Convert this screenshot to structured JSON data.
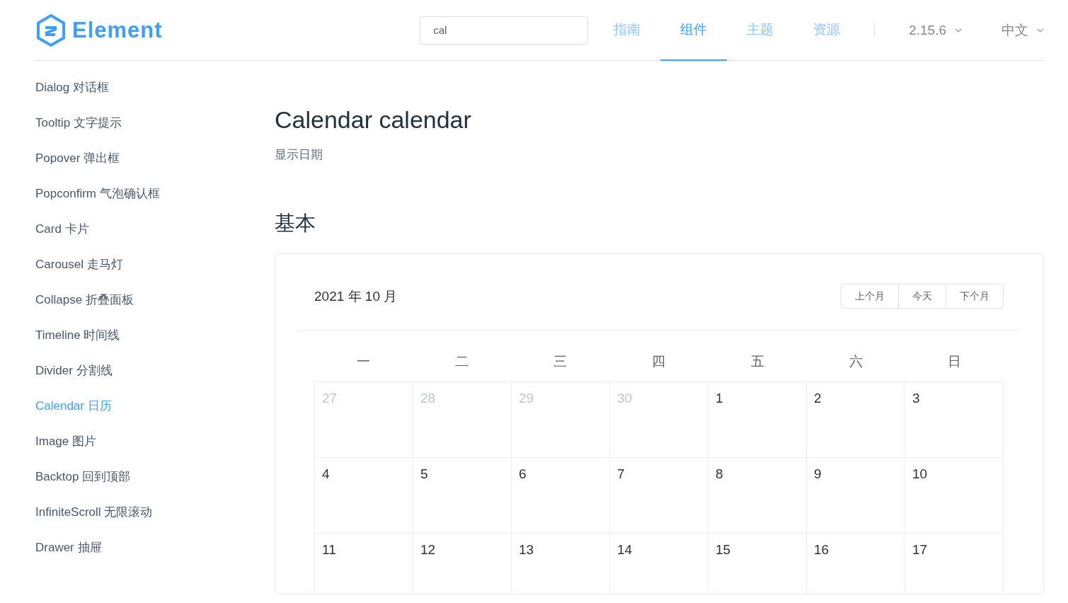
{
  "header": {
    "logo": "Element",
    "search": {
      "value": "cal"
    },
    "nav": [
      {
        "label": "指南",
        "selected": false
      },
      {
        "label": "组件",
        "selected": true
      },
      {
        "label": "主题",
        "selected": false
      },
      {
        "label": "资源",
        "selected": false
      }
    ],
    "version": "2.15.6",
    "language": "中文"
  },
  "sidebar": {
    "items": [
      {
        "label": "Dialog 对话框",
        "selected": false
      },
      {
        "label": "Tooltip 文字提示",
        "selected": false
      },
      {
        "label": "Popover 弹出框",
        "selected": false
      },
      {
        "label": "Popconfirm 气泡确认框",
        "selected": false
      },
      {
        "label": "Card 卡片",
        "selected": false
      },
      {
        "label": "Carousel 走马灯",
        "selected": false
      },
      {
        "label": "Collapse 折叠面板",
        "selected": false
      },
      {
        "label": "Timeline 时间线",
        "selected": false
      },
      {
        "label": "Divider 分割线",
        "selected": false
      },
      {
        "label": "Calendar 日历",
        "selected": true
      },
      {
        "label": "Image 图片",
        "selected": false
      },
      {
        "label": "Backtop 回到顶部",
        "selected": false
      },
      {
        "label": "InfiniteScroll 无限滚动",
        "selected": false
      },
      {
        "label": "Drawer 抽屉",
        "selected": false
      }
    ]
  },
  "main": {
    "title": "Calendar calendar",
    "description": "显示日期",
    "section": "基本",
    "calendar": {
      "title": "2021 年 10 月",
      "buttons": [
        "上个月",
        "今天",
        "下个月"
      ],
      "weekdays": [
        "一",
        "二",
        "三",
        "四",
        "五",
        "六",
        "日"
      ],
      "days": [
        {
          "label": "27",
          "current_month": false
        },
        {
          "label": "28",
          "current_month": false
        },
        {
          "label": "29",
          "current_month": false
        },
        {
          "label": "30",
          "current_month": false
        },
        {
          "label": "1",
          "current_month": true
        },
        {
          "label": "2",
          "current_month": true
        },
        {
          "label": "3",
          "current_month": true
        },
        {
          "label": "4",
          "current_month": true
        },
        {
          "label": "5",
          "current_month": true
        },
        {
          "label": "6",
          "current_month": true
        },
        {
          "label": "7",
          "current_month": true
        },
        {
          "label": "8",
          "current_month": true
        },
        {
          "label": "9",
          "current_month": true
        },
        {
          "label": "10",
          "current_month": true
        },
        {
          "label": "11",
          "current_month": true
        },
        {
          "label": "12",
          "current_month": true
        },
        {
          "label": "13",
          "current_month": true
        },
        {
          "label": "14",
          "current_month": true
        },
        {
          "label": "15",
          "current_month": true
        },
        {
          "label": "16",
          "current_month": true
        },
        {
          "label": "17",
          "current_month": true
        }
      ]
    }
  }
}
